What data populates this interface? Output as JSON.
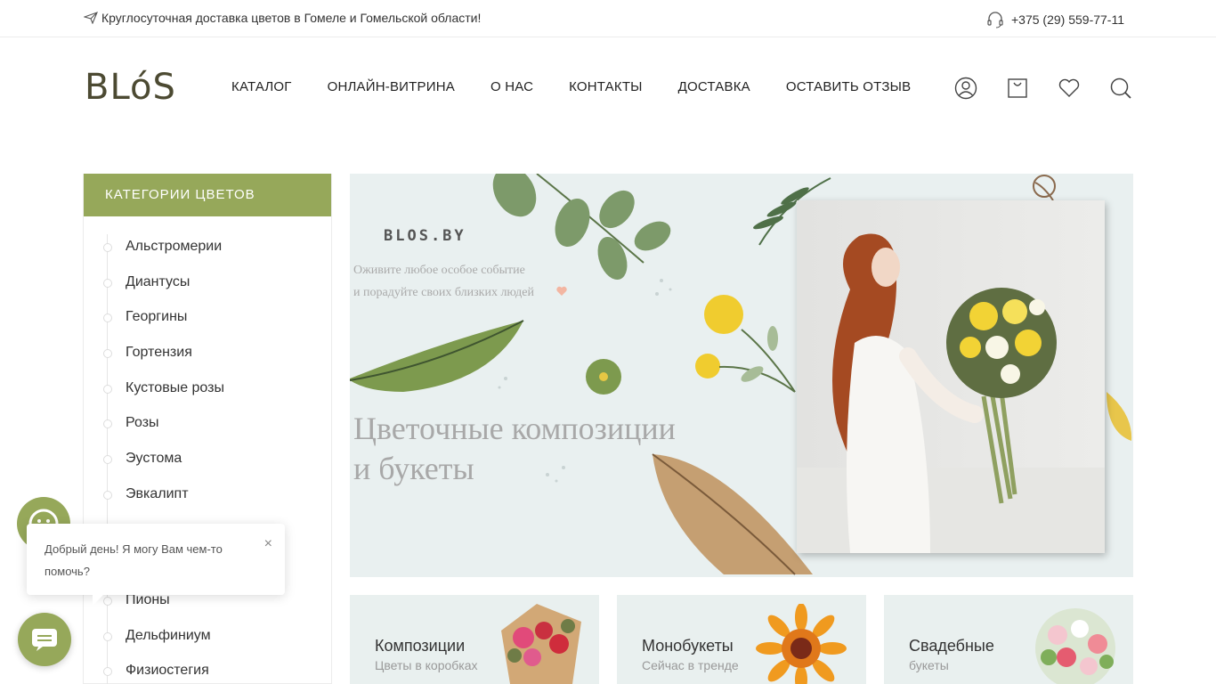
{
  "topbar": {
    "delivery_message": "Круглосуточная доставка цветов в Гомеле и Гомельской области!",
    "phone": "+375 (29) 559-77-11"
  },
  "header": {
    "logo": "BLóS",
    "nav": [
      "КАТАЛОГ",
      "ОНЛАЙН-ВИТРИНА",
      "О НАС",
      "КОНТАКТЫ",
      "ДОСТАВКА",
      "ОСТАВИТЬ ОТЗЫВ"
    ],
    "icons": [
      "user-icon",
      "cart-icon",
      "heart-icon",
      "search-icon"
    ]
  },
  "sidebar": {
    "title": "КАТЕГОРИИ ЦВЕТОВ",
    "items": [
      "Альстромерии",
      "Диантусы",
      "Георгины",
      "Гортензия",
      "Кустовые розы",
      "Розы",
      "Эустома",
      "Эвкалипт",
      "",
      "",
      "Пионы",
      "Дельфиниум",
      "Физиостегия"
    ]
  },
  "banner": {
    "brand": "BLOS.BY",
    "sub_line1": "Оживите любое особое событие",
    "sub_line2": "и порадуйте своих близких людей",
    "headline_line1": "Цветочные композиции",
    "headline_line2": "и букеты"
  },
  "cards": [
    {
      "title": "Композиции",
      "subtitle": "Цветы в коробках"
    },
    {
      "title": "Монобукеты",
      "subtitle": "Сейчас в тренде"
    },
    {
      "title": "Свадебные",
      "subtitle": "букеты"
    }
  ],
  "chat": {
    "greeting": "Добрый день! Я могу Вам чем-то помочь?",
    "close": "×"
  },
  "colors": {
    "accent": "#96a85a",
    "logo": "#4c4a32",
    "banner_bg": "#e9f0f0"
  }
}
